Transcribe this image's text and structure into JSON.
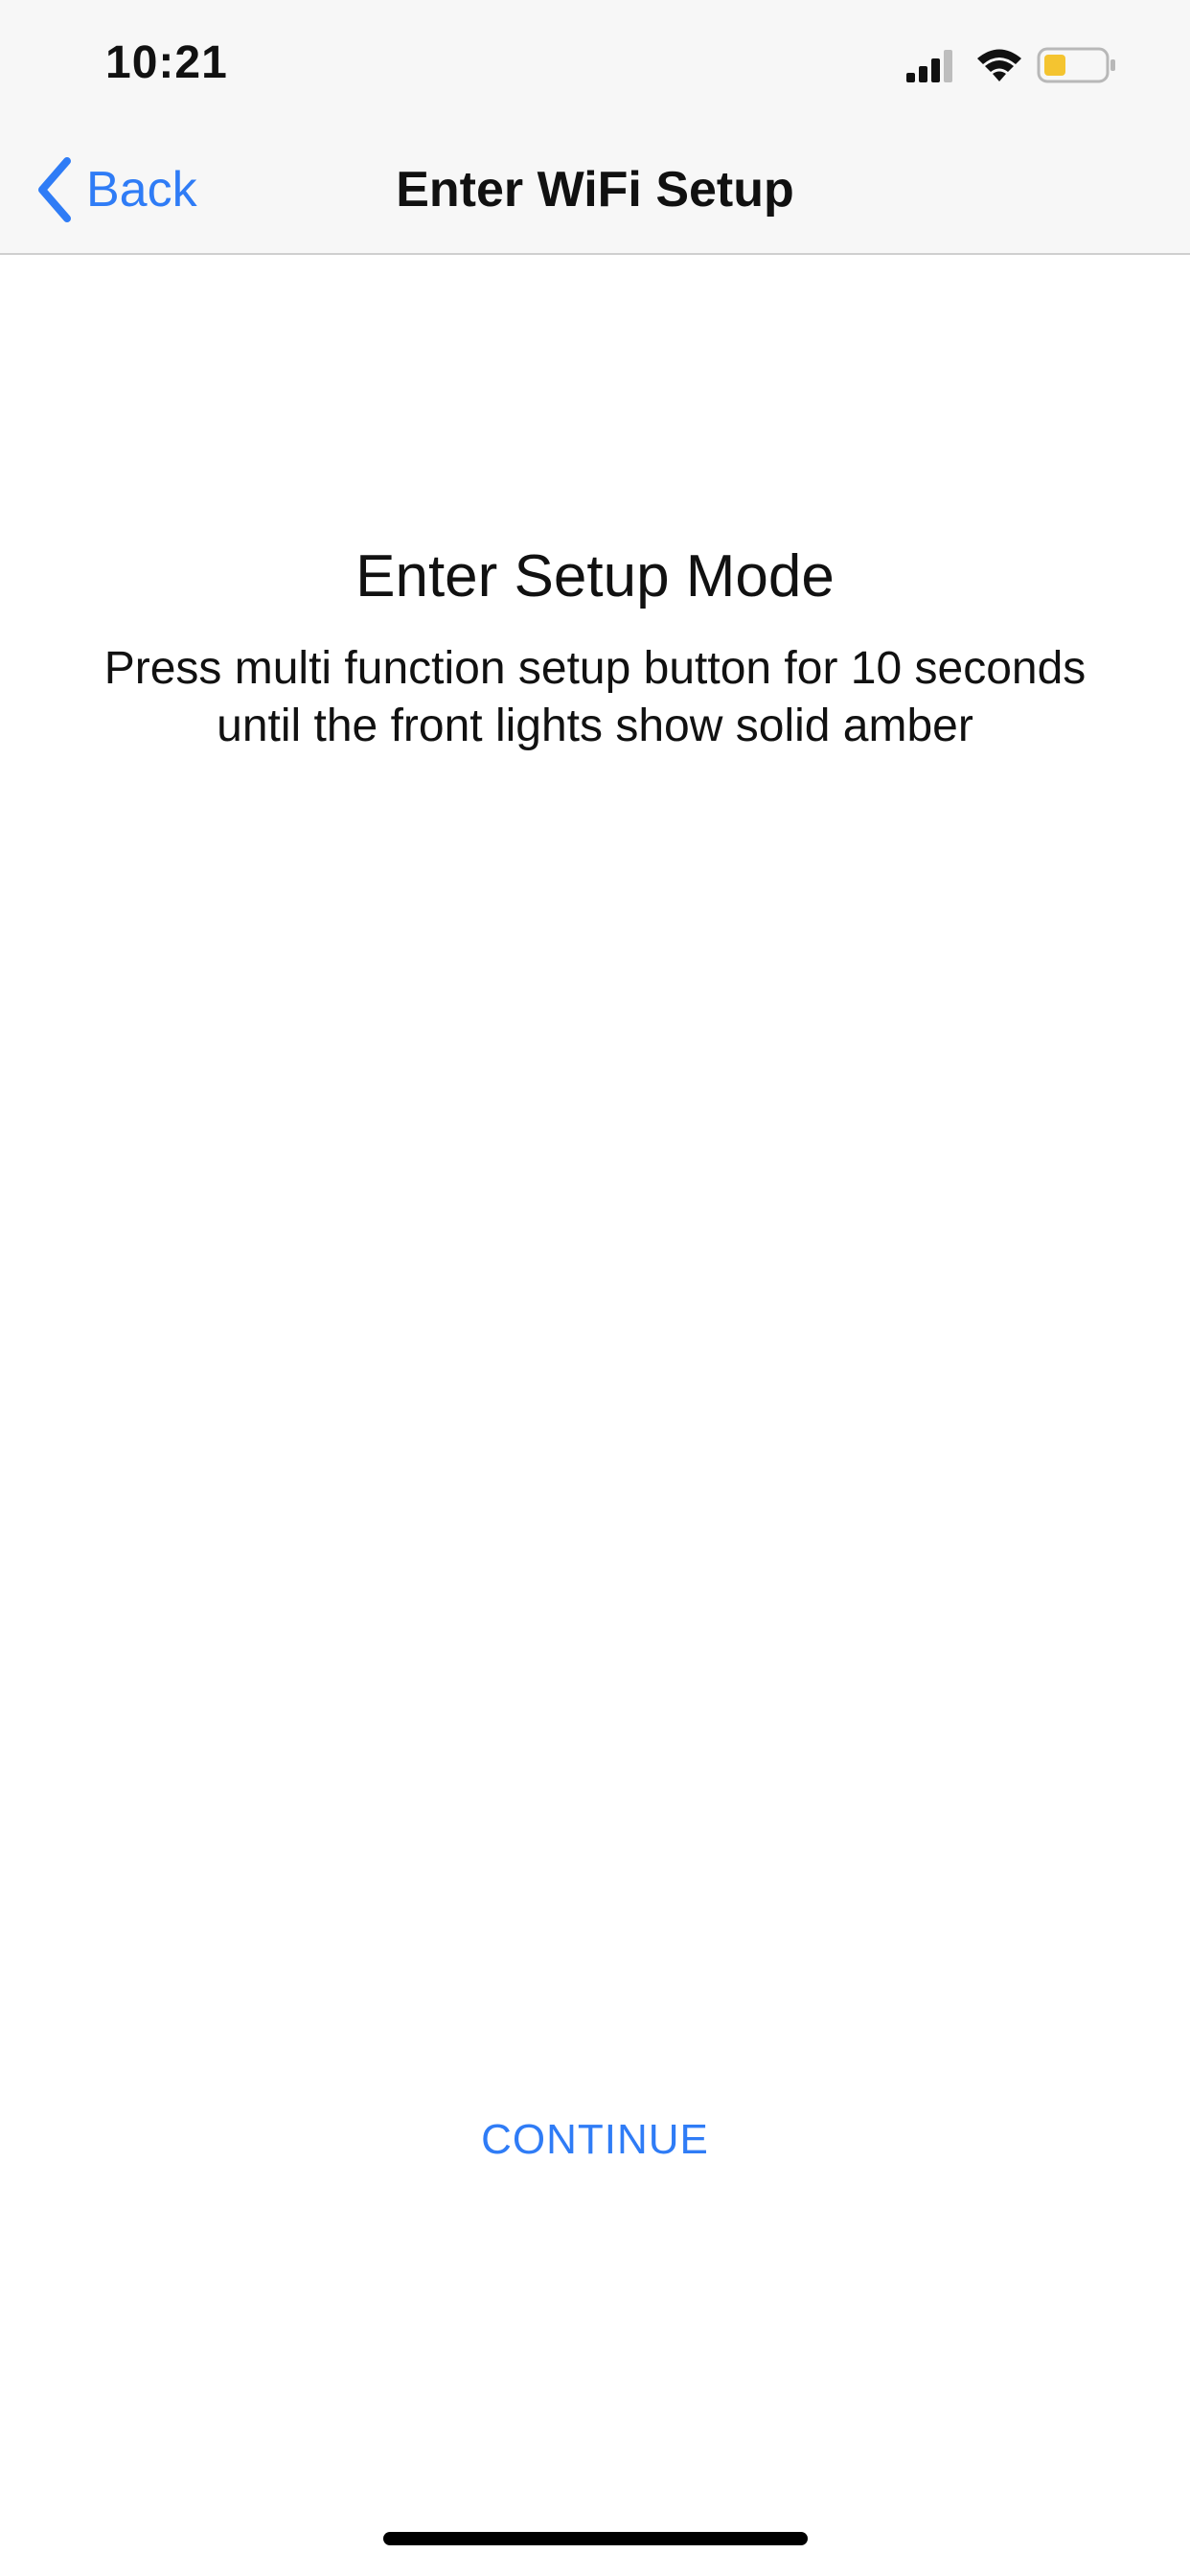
{
  "status_bar": {
    "time": "10:21",
    "signal_icon": "cellular-signal-icon",
    "wifi_icon": "wifi-icon",
    "battery_icon": "battery-icon",
    "battery_color": "#f4c430"
  },
  "nav_bar": {
    "back_label": "Back",
    "title": "Enter WiFi Setup",
    "accent_color": "#2f7cf6"
  },
  "content": {
    "title": "Enter Setup Mode",
    "description": "Press multi function setup button for 10 seconds until the front lights show solid amber"
  },
  "actions": {
    "continue_label": "CONTINUE"
  }
}
